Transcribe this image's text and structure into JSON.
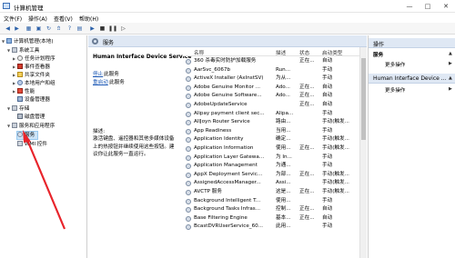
{
  "window": {
    "title": "计算机管理"
  },
  "menu": [
    "文件(F)",
    "操作(A)",
    "查看(V)",
    "帮助(H)"
  ],
  "toolbar_icons": [
    "back-icon",
    "forward-icon",
    "up-icon",
    "show-hide-tree-icon",
    "refresh-icon",
    "export-icon",
    "help-icon",
    "properties-icon",
    "play-icon",
    "stop-icon",
    "pause-icon",
    "restart-icon"
  ],
  "tree": {
    "root": "计算机管理(本地)",
    "system_tools": "系统工具",
    "task_scheduler": "任务计划程序",
    "event_viewer": "事件查看器",
    "shared_folders": "共享文件夹",
    "local_users": "本地用户和组",
    "performance": "性能",
    "device_manager": "设备管理器",
    "storage": "存储",
    "disk_management": "磁盘管理",
    "services_apps": "服务和应用程序",
    "services": "服务",
    "wmi": "WMI 控件"
  },
  "center": {
    "header": "服务",
    "selected_service": "Human Interface Device Service",
    "stop_link": "停止",
    "stop_rest": "此服务",
    "restart_link": "重启动",
    "restart_rest": "此服务",
    "desc_label": "描述:",
    "description": "激活键盘、遥控器和其他多媒体设备上的热按钮并继续使用这些按钮。建议你让此服务一直运行。"
  },
  "columns": {
    "name": "名称",
    "desc": "描述",
    "status": "状态",
    "startup": "启动类型"
  },
  "services": [
    {
      "name": "360 杀毒实时防护加载服务",
      "desc": "",
      "status": "正在...",
      "startup": "自动"
    },
    {
      "name": "AarSvc_6067b",
      "desc": "Run...",
      "status": "",
      "startup": "手动"
    },
    {
      "name": "ActiveX Installer (AxInstSV)",
      "desc": "为从...",
      "status": "",
      "startup": "手动"
    },
    {
      "name": "Adobe Genuine Monitor ...",
      "desc": "Ado...",
      "status": "正在...",
      "startup": "自动"
    },
    {
      "name": "Adobe Genuine Software...",
      "desc": "Ado...",
      "status": "正在...",
      "startup": "自动"
    },
    {
      "name": "AdobeUpdateService",
      "desc": "",
      "status": "正在...",
      "startup": "自动"
    },
    {
      "name": "Alipay payment client sec...",
      "desc": "Alipa...",
      "status": "",
      "startup": "手动"
    },
    {
      "name": "AllJoyn Router Service",
      "desc": "路由...",
      "status": "",
      "startup": "手动(触发..."
    },
    {
      "name": "App Readiness",
      "desc": "当用...",
      "status": "",
      "startup": "手动"
    },
    {
      "name": "Application Identity",
      "desc": "确定...",
      "status": "",
      "startup": "手动(触发..."
    },
    {
      "name": "Application Information",
      "desc": "使用...",
      "status": "正在...",
      "startup": "手动(触发..."
    },
    {
      "name": "Application Layer Gatewa...",
      "desc": "为 In...",
      "status": "",
      "startup": "手动"
    },
    {
      "name": "Application Management",
      "desc": "为通...",
      "status": "",
      "startup": "手动"
    },
    {
      "name": "AppX Deployment Servic...",
      "desc": "为部...",
      "status": "正在...",
      "startup": "手动(触发..."
    },
    {
      "name": "AssignedAccessManager...",
      "desc": "Assi...",
      "status": "",
      "startup": "手动(触发..."
    },
    {
      "name": "AVCTP 服务",
      "desc": "这是...",
      "status": "正在...",
      "startup": "手动(触发..."
    },
    {
      "name": "Background Intelligent T...",
      "desc": "使用...",
      "status": "",
      "startup": "手动"
    },
    {
      "name": "Background Tasks Infras...",
      "desc": "控制...",
      "status": "正在...",
      "startup": "自动"
    },
    {
      "name": "Base Filtering Engine",
      "desc": "基本...",
      "status": "正在...",
      "startup": "自动"
    },
    {
      "name": "BcastDVRUserService_60...",
      "desc": "此用...",
      "status": "",
      "startup": "手动"
    }
  ],
  "actions": {
    "header1": "操作",
    "services": "服务",
    "more1": "更多操作",
    "header2": "Human Interface Device ...",
    "more2": "更多操作"
  },
  "colors": {
    "accent_header": "#dfe8f4",
    "selection": "#cce4f7",
    "link": "#1a57b5",
    "arrow": "#e8242b"
  }
}
